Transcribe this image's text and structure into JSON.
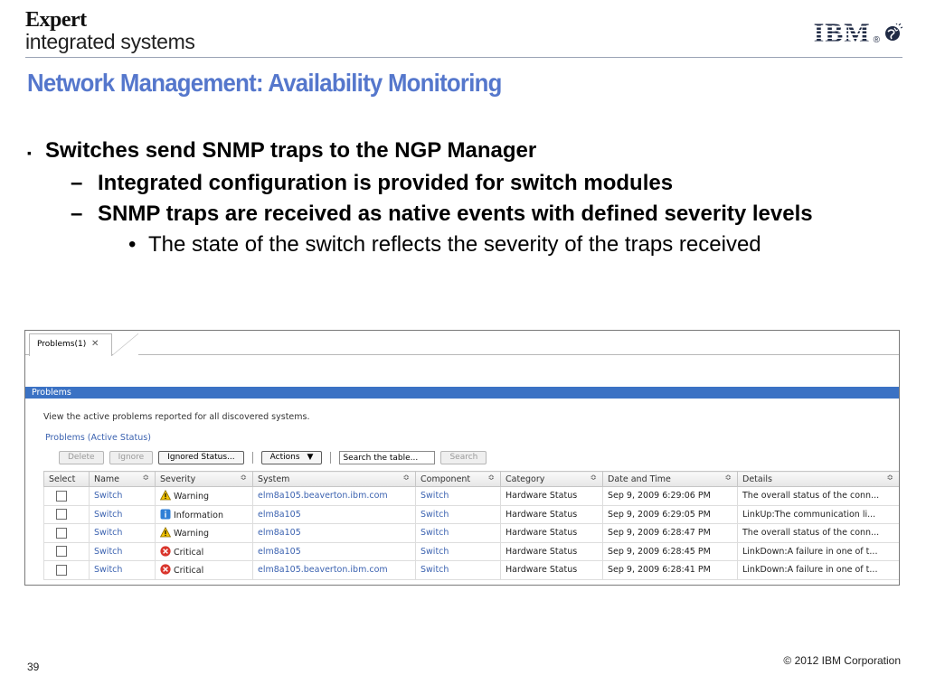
{
  "header": {
    "brand_line1": "Expert",
    "brand_line2": "integrated systems",
    "ibm_logo": "IBM",
    "logo_mark": "globe-icon"
  },
  "slide": {
    "title": "Network Management: Availability Monitoring",
    "bullets": {
      "l1": "Switches send SNMP traps to the NGP Manager",
      "l2a": "Integrated configuration is provided for switch modules",
      "l2b": "SNMP traps are received as native events with defined severity levels",
      "l3": "The state of the switch reflects the severity of the traps received"
    },
    "markers": {
      "square": "▪",
      "dash": "–",
      "dot": "•"
    }
  },
  "screenshot": {
    "tab_label": "Problems(1)",
    "tab_close": "✕",
    "section_bar": "Problems",
    "description": "View the active problems reported for all discovered systems.",
    "subtitle": "Problems (Active Status)",
    "toolbar": {
      "delete": "Delete",
      "ignore": "Ignore",
      "ignored_status": "Ignored Status...",
      "actions": "Actions",
      "search_value": "Search the table...",
      "search_btn": "Search"
    },
    "columns": [
      "Select",
      "Name",
      "Severity",
      "System",
      "Component",
      "Category",
      "Date and Time",
      "Details"
    ],
    "rows": [
      {
        "name": "Switch",
        "severity": "Warning",
        "system": "elm8a105.beaverton.ibm.com",
        "component": "Switch",
        "category": "Hardware Status",
        "datetime": "Sep 9, 2009 6:29:06 PM",
        "details": "The overall status of the conn..."
      },
      {
        "name": "Switch",
        "severity": "Information",
        "system": "elm8a105",
        "component": "Switch",
        "category": "Hardware Status",
        "datetime": "Sep 9, 2009 6:29:05 PM",
        "details": "LinkUp:The communication li..."
      },
      {
        "name": "Switch",
        "severity": "Warning",
        "system": "elm8a105",
        "component": "Switch",
        "category": "Hardware Status",
        "datetime": "Sep 9, 2009 6:28:47 PM",
        "details": "The overall status of the conn..."
      },
      {
        "name": "Switch",
        "severity": "Critical",
        "system": "elm8a105",
        "component": "Switch",
        "category": "Hardware Status",
        "datetime": "Sep 9, 2009 6:28:45 PM",
        "details": "LinkDown:A failure in one of t..."
      },
      {
        "name": "Switch",
        "severity": "Critical",
        "system": "elm8a105.beaverton.ibm.com",
        "component": "Switch",
        "category": "Hardware Status",
        "datetime": "Sep 9, 2009 6:28:41 PM",
        "details": "LinkDown:A failure in one of t..."
      }
    ],
    "colors": {
      "bar": "#3b72c4",
      "link": "#3b62b0",
      "warning": "#f2c200",
      "information": "#2f7fd6",
      "critical": "#d9342b"
    }
  },
  "footer": {
    "page_number": "39",
    "copyright": "© 2012 IBM Corporation"
  }
}
